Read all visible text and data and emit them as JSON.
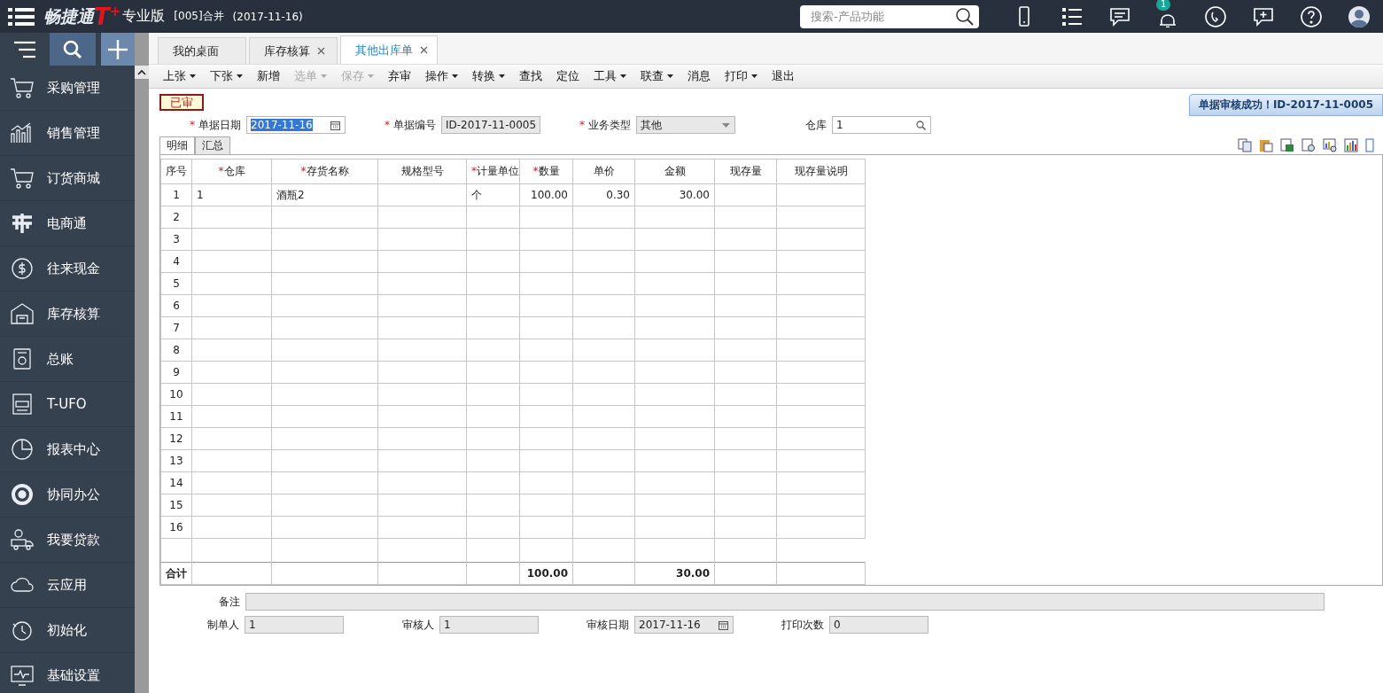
{
  "header": {
    "brand": "畅捷通",
    "brand_mark": "T",
    "brand_plus": "+",
    "edition": "专业版",
    "account": "[005]合并",
    "date": "(2017-11-16)",
    "search": {
      "placeholder": "搜索-产品功能"
    },
    "notification_count": "1"
  },
  "sidebar": {
    "items": [
      {
        "label": "采购管理"
      },
      {
        "label": "销售管理"
      },
      {
        "label": "订货商城"
      },
      {
        "label": "电商通"
      },
      {
        "label": "往来现金"
      },
      {
        "label": "库存核算"
      },
      {
        "label": "总账"
      },
      {
        "label": "T-UFO"
      },
      {
        "label": "报表中心"
      },
      {
        "label": "协同办公"
      },
      {
        "label": "我要贷款"
      },
      {
        "label": "云应用"
      },
      {
        "label": "初始化"
      },
      {
        "label": "基础设置"
      }
    ]
  },
  "tabs": [
    {
      "label": "我的桌面",
      "selected": false,
      "closable": false
    },
    {
      "label": "库存核算",
      "selected": false,
      "closable": true
    },
    {
      "label": "其他出库单",
      "selected": true,
      "closable": true
    }
  ],
  "toolbar": [
    {
      "label": "上张",
      "dropdown": true,
      "disabled": false
    },
    {
      "label": "下张",
      "dropdown": true,
      "disabled": false
    },
    {
      "label": "新增",
      "dropdown": false,
      "disabled": false
    },
    {
      "label": "选单",
      "dropdown": true,
      "disabled": true
    },
    {
      "label": "保存",
      "dropdown": true,
      "disabled": true
    },
    {
      "label": "弃审",
      "dropdown": false,
      "disabled": false
    },
    {
      "label": "操作",
      "dropdown": true,
      "disabled": false
    },
    {
      "label": "转换",
      "dropdown": true,
      "disabled": false
    },
    {
      "label": "查找",
      "dropdown": false,
      "disabled": false
    },
    {
      "label": "定位",
      "dropdown": false,
      "disabled": false
    },
    {
      "label": "工具",
      "dropdown": true,
      "disabled": false
    },
    {
      "label": "联查",
      "dropdown": true,
      "disabled": false
    },
    {
      "label": "消息",
      "dropdown": false,
      "disabled": false
    },
    {
      "label": "打印",
      "dropdown": true,
      "disabled": false
    },
    {
      "label": "退出",
      "dropdown": false,
      "disabled": false
    }
  ],
  "status_stamp": "已审",
  "message": "单据审核成功！ID-2017-11-0005",
  "header_fields": [
    {
      "mark": "*",
      "label": "单据日期",
      "kind": "date",
      "value": "2017-11-16",
      "text_selected": true
    },
    {
      "mark": "*",
      "label": "单据编号",
      "kind": "text",
      "value": "ID-2017-11-0005",
      "text_selected": false
    },
    {
      "mark": "*",
      "label": "业务类型",
      "kind": "select",
      "value": "其他",
      "text_selected": false
    },
    {
      "label": "仓库",
      "kind": "lookup",
      "value": "1",
      "text_selected": false
    }
  ],
  "subtabs": [
    {
      "label": "明细",
      "selected": true
    },
    {
      "label": "汇总",
      "selected": false
    }
  ],
  "table": {
    "columns": [
      {
        "label": "序号"
      },
      {
        "mark": "*",
        "label": "仓库"
      },
      {
        "mark": "*",
        "label": "存货名称"
      },
      {
        "label": "规格型号"
      },
      {
        "mark": "*",
        "label": "计量单位"
      },
      {
        "mark": "*",
        "label": "数量"
      },
      {
        "label": "单价"
      },
      {
        "label": "金额"
      },
      {
        "label": "现存量"
      },
      {
        "label": "现存量说明"
      }
    ],
    "rows": [
      {
        "no": "1",
        "warehouse": "1",
        "item": "酒瓶2",
        "unit": "个",
        "qty": "100.00",
        "price": "0.30",
        "amount": "30.00"
      },
      {
        "no": "2"
      },
      {
        "no": "3"
      },
      {
        "no": "4"
      },
      {
        "no": "5"
      },
      {
        "no": "6"
      },
      {
        "no": "7"
      },
      {
        "no": "8"
      },
      {
        "no": "9"
      },
      {
        "no": "10"
      },
      {
        "no": "11"
      },
      {
        "no": "12"
      },
      {
        "no": "13"
      },
      {
        "no": "14"
      },
      {
        "no": "15"
      },
      {
        "no": "16"
      }
    ],
    "total": {
      "label": "合计",
      "qty": "100.00",
      "amount": "30.00"
    }
  },
  "footer_fields": [
    {
      "label": "备注",
      "kind": "wide"
    },
    {
      "label": "制单人",
      "kind": "text",
      "value": "1"
    },
    {
      "label": "审核人",
      "kind": "text",
      "value": "1"
    },
    {
      "label": "审核日期",
      "kind": "date",
      "value": "2017-11-16"
    },
    {
      "label": "打印次数",
      "kind": "text",
      "value": "0"
    }
  ]
}
